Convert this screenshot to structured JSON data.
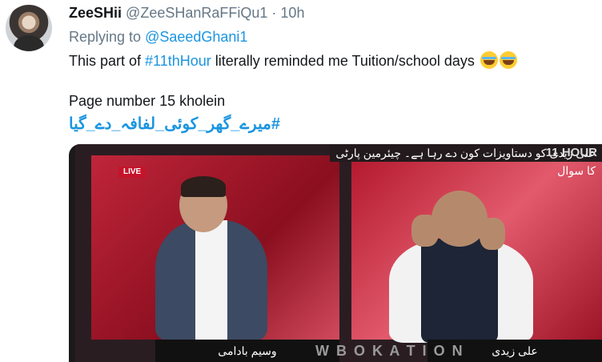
{
  "tweet": {
    "name": "ZeeSHii",
    "handle": "@ZeeSHanRaFFiQu1",
    "separator": "·",
    "time": "10h",
    "replying_prefix": "Replying to",
    "replying_to": "@SaeedGhani1",
    "text_part1": "This part of ",
    "hashtag": "#11thHour",
    "text_part2": " literally reminded me Tuition/school days",
    "line2": "Page number 15 kholein",
    "urdu_hashtag": "#میرے_گھر_کوئی_لفافہ_دے_گیا"
  },
  "media": {
    "ticker": "علی زیدی کو دستاویزات کون دے رہا ہے۔ چیئرمین پارٹی کا سوال",
    "logo": "11 HOUR",
    "live": "LIVE",
    "name_left": "وسیم بادامی",
    "name_right": "علی زیدی",
    "watermark": "W B O K A T I O N"
  }
}
